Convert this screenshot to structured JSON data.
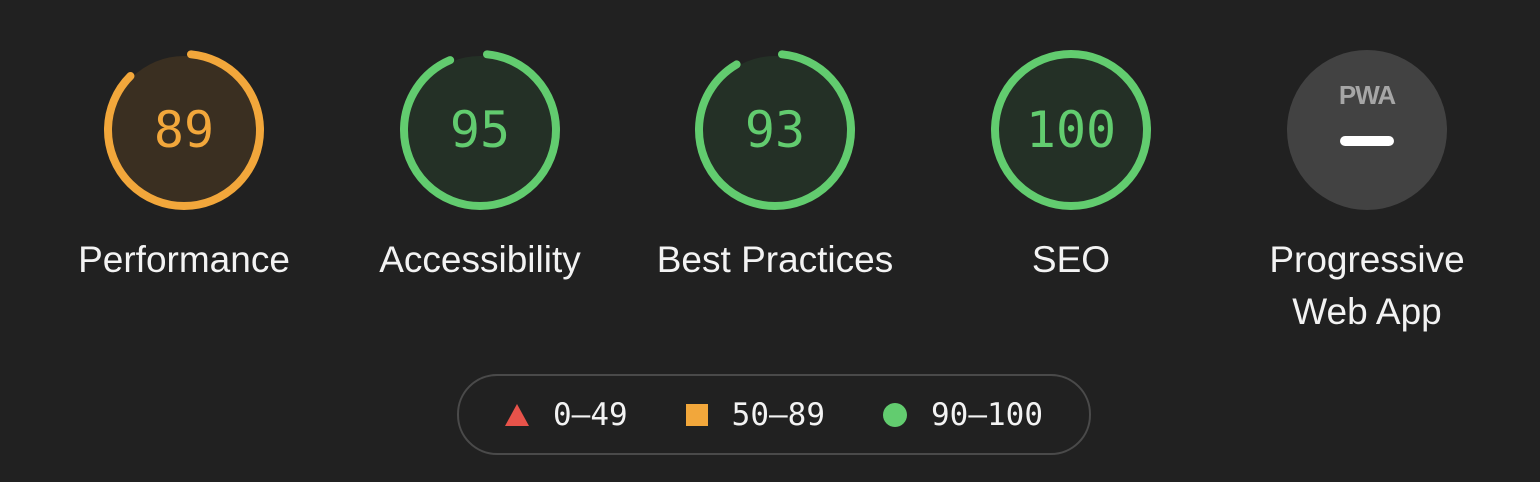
{
  "gauges": [
    {
      "score": "89",
      "label": "Performance",
      "value": 89,
      "color": "#f2a73b",
      "fill": "#3a2f21"
    },
    {
      "score": "95",
      "label": "Accessibility",
      "value": 95,
      "color": "#62cc6f",
      "fill": "#243026"
    },
    {
      "score": "93",
      "label": "Best Practices",
      "value": 93,
      "color": "#62cc6f",
      "fill": "#243026"
    },
    {
      "score": "100",
      "label": "SEO",
      "value": 100,
      "color": "#62cc6f",
      "fill": "#243026"
    }
  ],
  "pwa": {
    "badge": "PWA",
    "label": "Progressive Web App",
    "icon": "pwa-dash-icon"
  },
  "legend": [
    {
      "range": "0–49",
      "icon": "triangle-icon",
      "color": "#e8534a"
    },
    {
      "range": "50–89",
      "icon": "square-icon",
      "color": "#f2a73b"
    },
    {
      "range": "90–100",
      "icon": "circle-icon",
      "color": "#62cc6f"
    }
  ]
}
